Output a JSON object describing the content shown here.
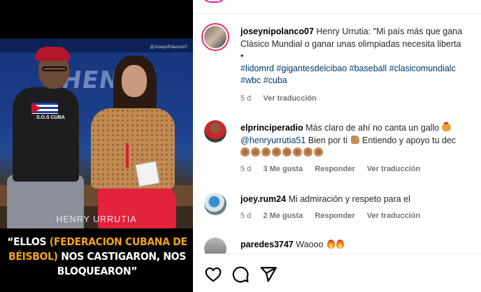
{
  "media": {
    "watermark": "@JoseynPolanco07",
    "shirt_text": "S.O.S CUBA",
    "wall_text": "HENRY",
    "overlay_name": "HENRY URRUTIA",
    "quote_part1": "“ELLOS ",
    "quote_highlight": "(FEDERACION CUBANA DE BÉISBOL)",
    "quote_part2": " NOS CASTIGARON, NOS BLOQUEARON”"
  },
  "caption": {
    "username": "joseynipolanco07",
    "text_line1": "Henry Urrutia: \"Mi país más que gana",
    "text_line2": "Clásico Mundial o ganar unas olimpiadas necesita liberta",
    "bullet": "•",
    "hashtags_line1": "#lidomrd #gigantesdelcibao #baseball #clasicomundialc",
    "hashtags_line2": "#wbc #cuba",
    "time": "5 d",
    "translate": "Ver traducción"
  },
  "comments": [
    {
      "username": "elprinciperadio",
      "text_line1": "Más claro de ahí no canta un gallo",
      "mention": "@henryurrutia51",
      "text_line2": "Bien por ti",
      "text_line2b": "Entiendo y apoyo tu dec",
      "clap_count": 8,
      "time": "5 d",
      "likes": "3 Me gusta",
      "reply": "Responder",
      "translate": "Ver traducción"
    },
    {
      "username": "joey.rum24",
      "text": "Mi admiración y respeto para el",
      "time": "5 d",
      "likes": "2 Me gusta",
      "reply": "Responder",
      "translate": "Ver traducción"
    },
    {
      "username": "paredes3747",
      "text": "Waooo"
    }
  ],
  "actions": {
    "like_icon": "heart-icon",
    "comment_icon": "comment-icon",
    "share_icon": "share-icon"
  },
  "colors": {
    "link_blue": "#00376b",
    "meta_gray": "#737373",
    "highlight_orange": "#f2a31b",
    "story_ring": "#e1306c"
  }
}
